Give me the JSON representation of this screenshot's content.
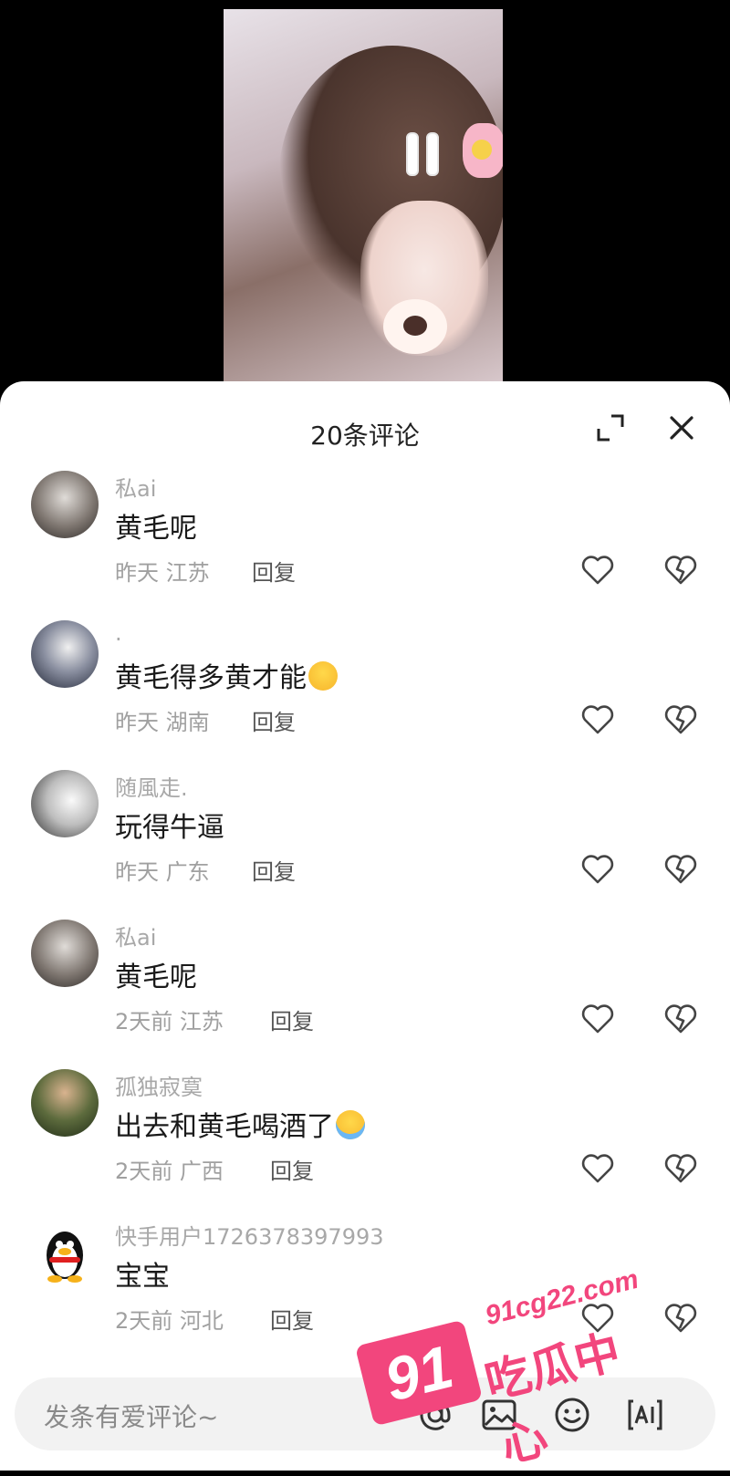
{
  "header": {
    "title": "20条评论"
  },
  "comments": [
    {
      "user": "私ai",
      "text": "黄毛呢",
      "time": "昨天",
      "region": "江苏",
      "reply": "回复",
      "emoji": ""
    },
    {
      "user": ".",
      "text": "黄毛得多黄才能",
      "time": "昨天",
      "region": "湖南",
      "reply": "回复",
      "emoji": "smiling-face-with-glasses"
    },
    {
      "user": "随風走.",
      "text": "玩得牛逼",
      "time": "昨天",
      "region": "广东",
      "reply": "回复",
      "emoji": ""
    },
    {
      "user": "私ai",
      "text": "黄毛呢",
      "time": "2天前",
      "region": "江苏",
      "reply": "回复",
      "emoji": ""
    },
    {
      "user": "孤独寂寞",
      "text": "出去和黄毛喝酒了",
      "time": "2天前",
      "region": "广西",
      "reply": "回复",
      "emoji": "crying-face"
    },
    {
      "user": "快手用户1726378397993",
      "text": "宝宝",
      "time": "2天前",
      "region": "河北",
      "reply": "回复",
      "emoji": ""
    }
  ],
  "input": {
    "placeholder": "发条有爱评论~"
  },
  "watermark": {
    "number": "91",
    "url": "91cg22.com",
    "name": "吃瓜中心"
  },
  "colors": {
    "watermark": "#f2467d",
    "sheet": "#ffffff",
    "backdrop": "#000000"
  }
}
